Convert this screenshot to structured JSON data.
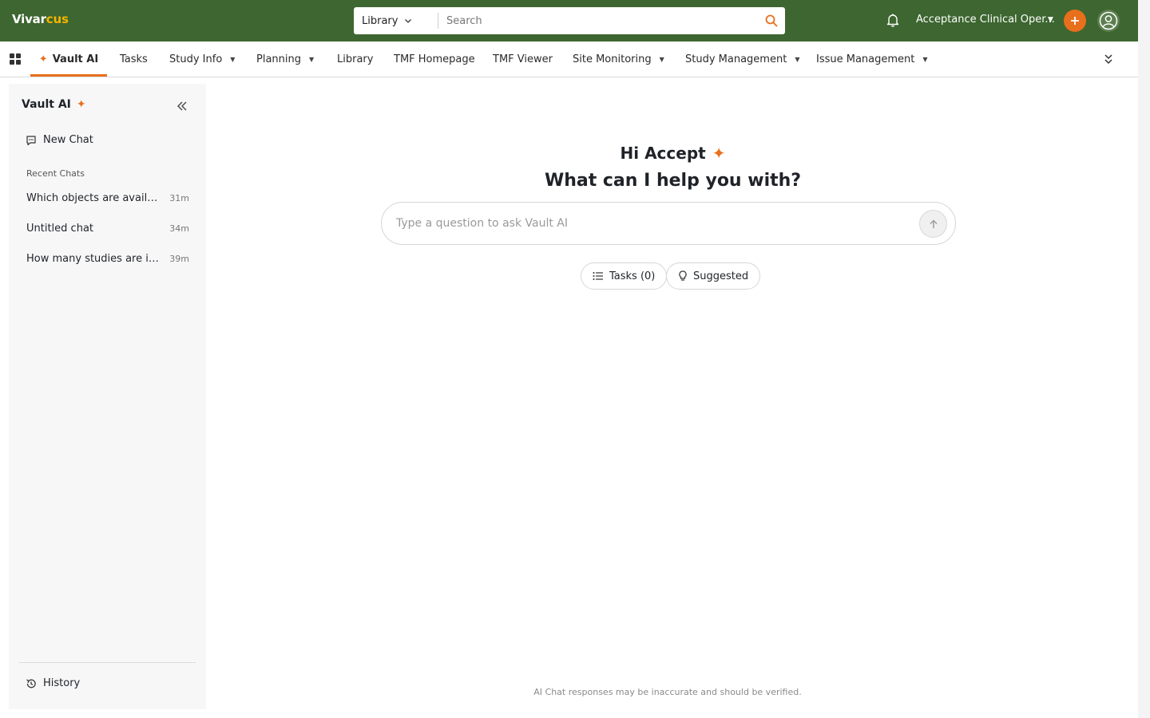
{
  "app": {
    "logo_part1": "Vivar",
    "logo_part2": "cus",
    "accent_color": "#e86f1c",
    "brand_color": "#3d6630"
  },
  "topbar": {
    "search_scope": "Library",
    "search_placeholder": "Search",
    "org_name": "Acceptance Clinical Oper...",
    "icons": [
      "bell-icon",
      "plus-icon",
      "user-icon"
    ]
  },
  "nav": {
    "tabs": [
      {
        "label": "Vault AI",
        "active": true,
        "dropdown": false
      },
      {
        "label": "Tasks",
        "active": false,
        "dropdown": false
      },
      {
        "label": "Study Info",
        "active": false,
        "dropdown": true
      },
      {
        "label": "Planning",
        "active": false,
        "dropdown": true
      },
      {
        "label": "Library",
        "active": false,
        "dropdown": false
      },
      {
        "label": "TMF Homepage",
        "active": false,
        "dropdown": false
      },
      {
        "label": "TMF Viewer",
        "active": false,
        "dropdown": false
      },
      {
        "label": "Site Monitoring",
        "active": false,
        "dropdown": true
      },
      {
        "label": "Study Management",
        "active": false,
        "dropdown": true
      },
      {
        "label": "Issue Management",
        "active": false,
        "dropdown": true
      }
    ]
  },
  "sidebar": {
    "title": "Vault AI",
    "new_chat": "New Chat",
    "recent_label": "Recent Chats",
    "chats": [
      {
        "title": "Which objects are available in this vault?",
        "time": "31m"
      },
      {
        "title": "Untitled chat",
        "time": "34m"
      },
      {
        "title": "How many studies are in this vault?",
        "time": "39m"
      }
    ],
    "history": "History"
  },
  "main": {
    "greeting": "Hi Accept",
    "prompt": "What can I help you with?",
    "input_placeholder": "Type a question to ask Vault AI",
    "tasks_chip": "Tasks (0)",
    "suggested_chip": "Suggested",
    "disclaimer": "AI Chat responses may be inaccurate and should be verified."
  }
}
